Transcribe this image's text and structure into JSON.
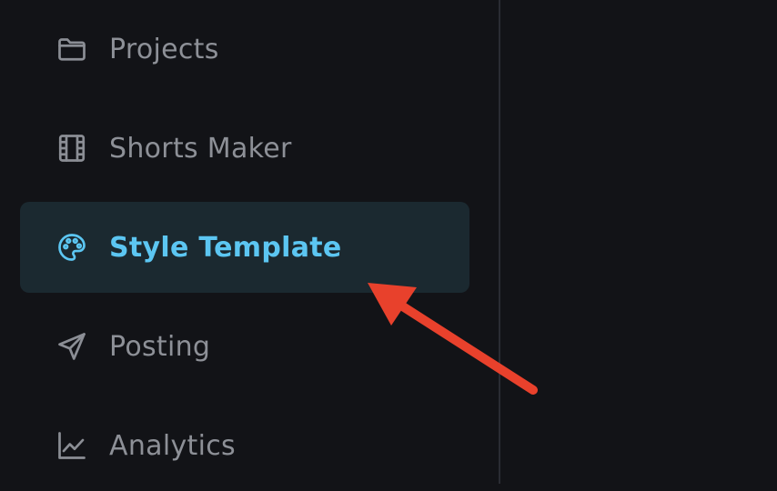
{
  "sidebar": {
    "items": [
      {
        "label": "Projects",
        "icon": "folder-icon",
        "active": false
      },
      {
        "label": "Shorts Maker",
        "icon": "film-icon",
        "active": false
      },
      {
        "label": "Style Template",
        "icon": "palette-icon",
        "active": true
      },
      {
        "label": "Posting",
        "icon": "send-icon",
        "active": false
      },
      {
        "label": "Analytics",
        "icon": "chart-line-icon",
        "active": false
      }
    ]
  },
  "colors": {
    "background": "#121317",
    "inactive_text": "#8d9097",
    "active_text": "#5cc6f2",
    "active_background": "#1b2930",
    "annotation_arrow": "#e8412c"
  },
  "annotation": {
    "type": "arrow",
    "target": "sidebar-item-style-template"
  }
}
